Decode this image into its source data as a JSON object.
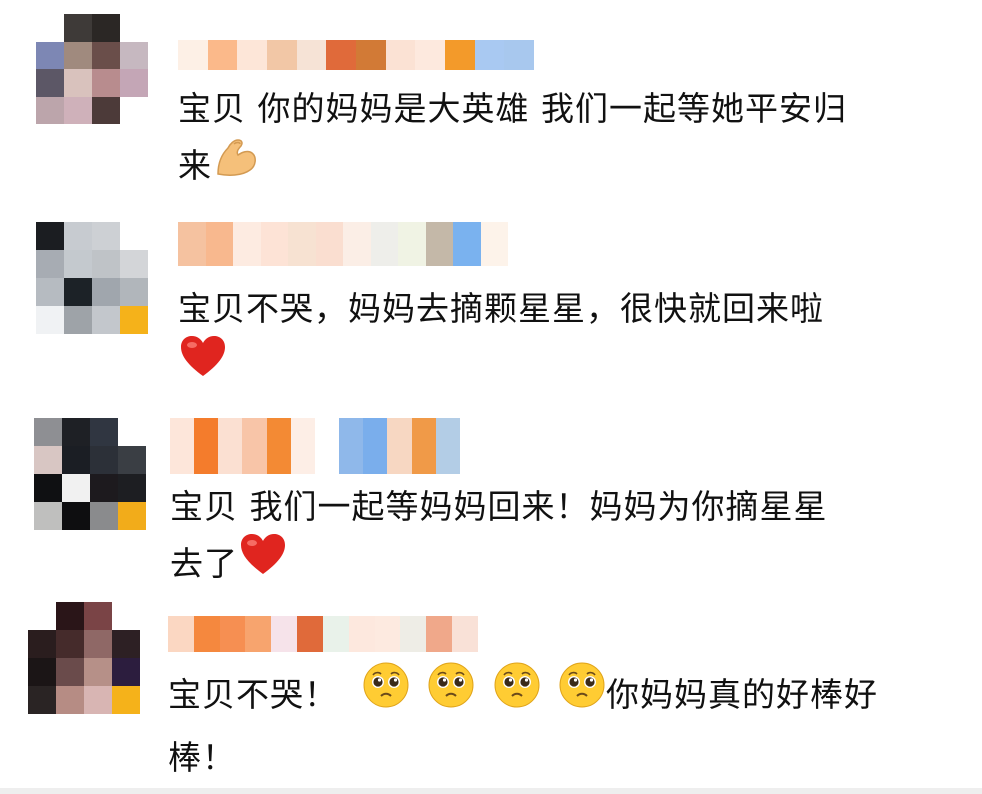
{
  "comments": [
    {
      "id": "c1",
      "lines": [
        "宝贝 你的妈妈是大英雄 我们一起等她平安归",
        "来"
      ],
      "emoji_after": [
        "flexed-biceps-icon"
      ],
      "avatar": [
        [
          "#ffffff",
          "#3e3a38",
          "#2b2725",
          "#ffffff"
        ],
        [
          "#7d87b4",
          "#a08a7e",
          "#6a4e4a",
          "#c6b8c0"
        ],
        [
          "#5c5766",
          "#d9c2bd",
          "#b88c8e",
          "#c4a6b6"
        ],
        [
          "#bca5ab",
          "#cfb1ba",
          "#4c3a39",
          "#ffffff"
        ]
      ],
      "name_pixels": [
        "#fdf0e6",
        "#fbb98a",
        "#fde6d8",
        "#f2c7a6",
        "#f6e3d6",
        "#e06a3a",
        "#d27a36",
        "#fbe2d4",
        "#fde9de",
        "#f39a2a",
        "#a9c9f2",
        "#a8c8ee"
      ]
    },
    {
      "id": "c2",
      "lines": [
        "宝贝不哭，妈妈去摘颗星星，很快就回来啦"
      ],
      "emoji_after": [
        "red-heart-icon"
      ],
      "avatar": [
        [
          "#1b1d21",
          "#c7cbd0",
          "#cdd0d4",
          "#ffffff"
        ],
        [
          "#a7acb3",
          "#c4c9ce",
          "#bfc3c7",
          "#d3d5d8"
        ],
        [
          "#b6bbc1",
          "#1c2227",
          "#a0a6ad",
          "#b1b6bb"
        ],
        [
          "#f0f2f4",
          "#9ea3a8",
          "#c3c7cc",
          "#f5b21a"
        ]
      ],
      "name_pixels": [
        "#f5c2a0",
        "#f8b88e",
        "#fdebe1",
        "#fde3d6",
        "#f7e2d2",
        "#faded0",
        "#fbeee6",
        "#eeeeea",
        "#f0f3e4",
        "#c4b8a8",
        "#7ab2ef",
        "#fdf3ea"
      ]
    },
    {
      "id": "c3",
      "lines": [
        "宝贝  我们一起等妈妈回来！妈妈为你摘星星",
        "去了"
      ],
      "emoji_after": [
        "red-heart-icon"
      ],
      "avatar": [
        [
          "#8e8f93",
          "#1e2025",
          "#303641",
          "#ffffff"
        ],
        [
          "#d8c6c3",
          "#1b1e24",
          "#2c3038",
          "#3a3e44"
        ],
        [
          "#0f1012",
          "#f1f1f1",
          "#1d1a1e",
          "#1d1e22"
        ],
        [
          "#bfbfbe",
          "#0e0e10",
          "#8a8b8d",
          "#f2ac1a"
        ]
      ],
      "name_pixels": [
        "#fde6da",
        "#f47c2c",
        "#fbe0d2",
        "#f8c5a8",
        "#f38a34",
        "#fdeee6",
        "#ffffff",
        "#8fb8ea",
        "#7aaeec",
        "#f7d7c2",
        "#f09a48",
        "#b3cde6"
      ]
    },
    {
      "id": "c4",
      "lines": [
        "宝贝不哭！",
        "棒！"
      ],
      "inline_emojis": [
        "pleading-face-icon",
        "pleading-face-icon",
        "pleading-face-icon",
        "pleading-face-icon"
      ],
      "line1_tail": "你妈妈真的好棒好",
      "avatar": [
        [
          "#ffffff",
          "#2a1518",
          "#7a4446",
          "#ffffff"
        ],
        [
          "#2a1d1e",
          "#452b2b",
          "#8f6866",
          "#2d2024"
        ],
        [
          "#1b1516",
          "#6a4b4b",
          "#b69088",
          "#2c1d3e"
        ],
        [
          "#2a2424",
          "#b68c84",
          "#d8b5b3",
          "#f5b21a"
        ]
      ],
      "name_pixels": [
        "#fbd7c2",
        "#f5883e",
        "#f68f52",
        "#f7a46e",
        "#f6e3ea",
        "#e06a3a",
        "#e9f2ea",
        "#fde8de",
        "#fdeae0",
        "#eeede6",
        "#f0a88a",
        "#f9e1d7"
      ]
    }
  ],
  "colors": {
    "heart": "#e0251f",
    "emoji_face": "#ffcc33",
    "biceps": "#f5c07a"
  }
}
